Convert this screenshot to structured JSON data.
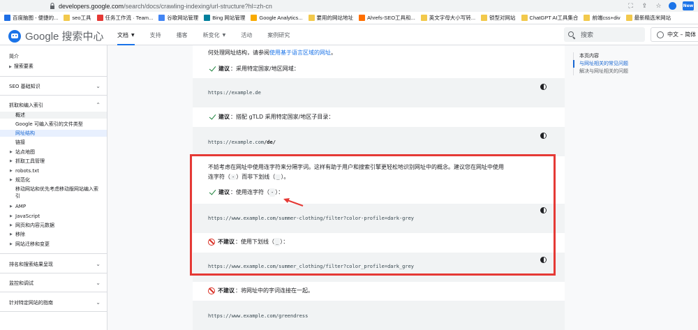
{
  "browser": {
    "url_host": "developers.google.com",
    "url_path": "/search/docs/crawling-indexing/url-structure?hl=zh-cn",
    "badge": "New"
  },
  "bookmarks": [
    {
      "label": "百度脑图 - 便捷的...",
      "color": "#1f6fe5"
    },
    {
      "label": "seo工具",
      "color": "#f2c94c"
    },
    {
      "label": "任务工作流 · Team...",
      "color": "#e53935"
    },
    {
      "label": "谷歌网站管理",
      "color": "#4285f4"
    },
    {
      "label": "Bing 网站管理",
      "color": "#00809d"
    },
    {
      "label": "Google Analytics...",
      "color": "#f9ab00"
    },
    {
      "label": "要用的网站地址",
      "color": "#f2c94c"
    },
    {
      "label": "Ahrefs-SEO工具和...",
      "color": "#ff6f00"
    },
    {
      "label": "英文字母大小写转...",
      "color": "#f2c94c"
    },
    {
      "label": "锁型对网站",
      "color": "#f2c94c"
    },
    {
      "label": "ChatGPT AI工具集合",
      "color": "#f2c94c"
    },
    {
      "label": "前端css+div",
      "color": "#f2c94c"
    },
    {
      "label": "最新精选米网站",
      "color": "#f2c94c"
    }
  ],
  "header": {
    "logo_text": "Google 搜索中心",
    "nav": [
      {
        "label": "文档",
        "has_caret": true,
        "active": true
      },
      {
        "label": "支持",
        "has_caret": false,
        "active": false
      },
      {
        "label": "播客",
        "has_caret": false,
        "active": false
      },
      {
        "label": "新变化",
        "has_caret": true,
        "active": false
      },
      {
        "label": "活动",
        "has_caret": false,
        "active": false
      },
      {
        "label": "案例研究",
        "has_caret": false,
        "active": false
      }
    ],
    "search_placeholder": "搜索",
    "language": "中文 – 简体"
  },
  "sidebar": {
    "intro": "简介",
    "search_essentials": "搜索要素",
    "sections": [
      {
        "label": "SEO 基础知识",
        "expanded": false
      },
      {
        "label": "抓取和编入索引",
        "expanded": true
      },
      {
        "label": "排名和搜索结果呈现",
        "expanded": false
      },
      {
        "label": "监控和调试",
        "expanded": false
      },
      {
        "label": "针对特定网站的指南",
        "expanded": false
      }
    ],
    "crawl_items": [
      {
        "label": "概述",
        "tri": false,
        "state": "hl"
      },
      {
        "label": "Google 可编入索引的文件类型",
        "tri": false,
        "state": ""
      },
      {
        "label": "网址结构",
        "tri": false,
        "state": "selected"
      },
      {
        "label": "链接",
        "tri": false,
        "state": ""
      },
      {
        "label": "站点地图",
        "tri": true,
        "state": ""
      },
      {
        "label": "抓取工具管理",
        "tri": true,
        "state": ""
      },
      {
        "label": "robots.txt",
        "tri": true,
        "state": ""
      },
      {
        "label": "规范化",
        "tri": true,
        "state": ""
      },
      {
        "label": "移动网站和优先考虑移动版网站编入索",
        "tri": false,
        "state": ""
      },
      {
        "label": "引",
        "tri": false,
        "state": ""
      },
      {
        "label": "AMP",
        "tri": true,
        "state": ""
      },
      {
        "label": "JavaScript",
        "tri": true,
        "state": ""
      },
      {
        "label": "网页和内容元数据",
        "tri": true,
        "state": ""
      },
      {
        "label": "移除",
        "tri": true,
        "state": ""
      },
      {
        "label": "网站迁移和变更",
        "tri": true,
        "state": ""
      }
    ]
  },
  "article": {
    "top_line": "何处理网址结构，请参阅",
    "top_link": "使用基于语言区域的网址",
    "top_end": "。",
    "rec1_label": "建议",
    "rec1_text": "：采用特定国家/地区网域：",
    "code1": "https://example.de",
    "rec2_label": "建议",
    "rec2_text": "：搭配 gTLD 采用特定国家/地区子目录：",
    "code2_prefix": "https://example.com",
    "code2_bold": "/de/",
    "para_line1": "不妨考虑在网址中使用连字符来分隔字词。这样有助于用户和搜索引擎更轻松地识别网址中的概念。建议您在网址中使用",
    "para_line2_a": "连字符（",
    "para_hyphen": "-",
    "para_line2_b": "）而非下划线（",
    "para_underscore": "_",
    "para_line2_c": "）。",
    "rec3_label": "建议",
    "rec3_text_a": "：使用连字符（",
    "rec3_text_b": "）：",
    "code3": "https://www.example.com/summer-clothing/filter?color-profile=dark-grey",
    "notrec1_label": "不建议",
    "notrec1_text_a": "：使用下划线（",
    "notrec1_text_b": "）：",
    "code4": "https://www.example.com/summer_clothing/filter?color_profile=dark_grey",
    "notrec2_label": "不建议",
    "notrec2_text": "：将网址中的字词连接在一起。",
    "code5": "https://www.example.com/greendress"
  },
  "toc": {
    "title": "本页内容",
    "items": [
      {
        "label": "与网址相关的常见问题",
        "active": true
      },
      {
        "label": "解决与网址相关的问题",
        "active": false
      }
    ]
  },
  "colors": {
    "accent": "#1a73e8",
    "highlight_box": "#e53935",
    "recommend": "#188038",
    "not_recommend": "#d93025"
  }
}
